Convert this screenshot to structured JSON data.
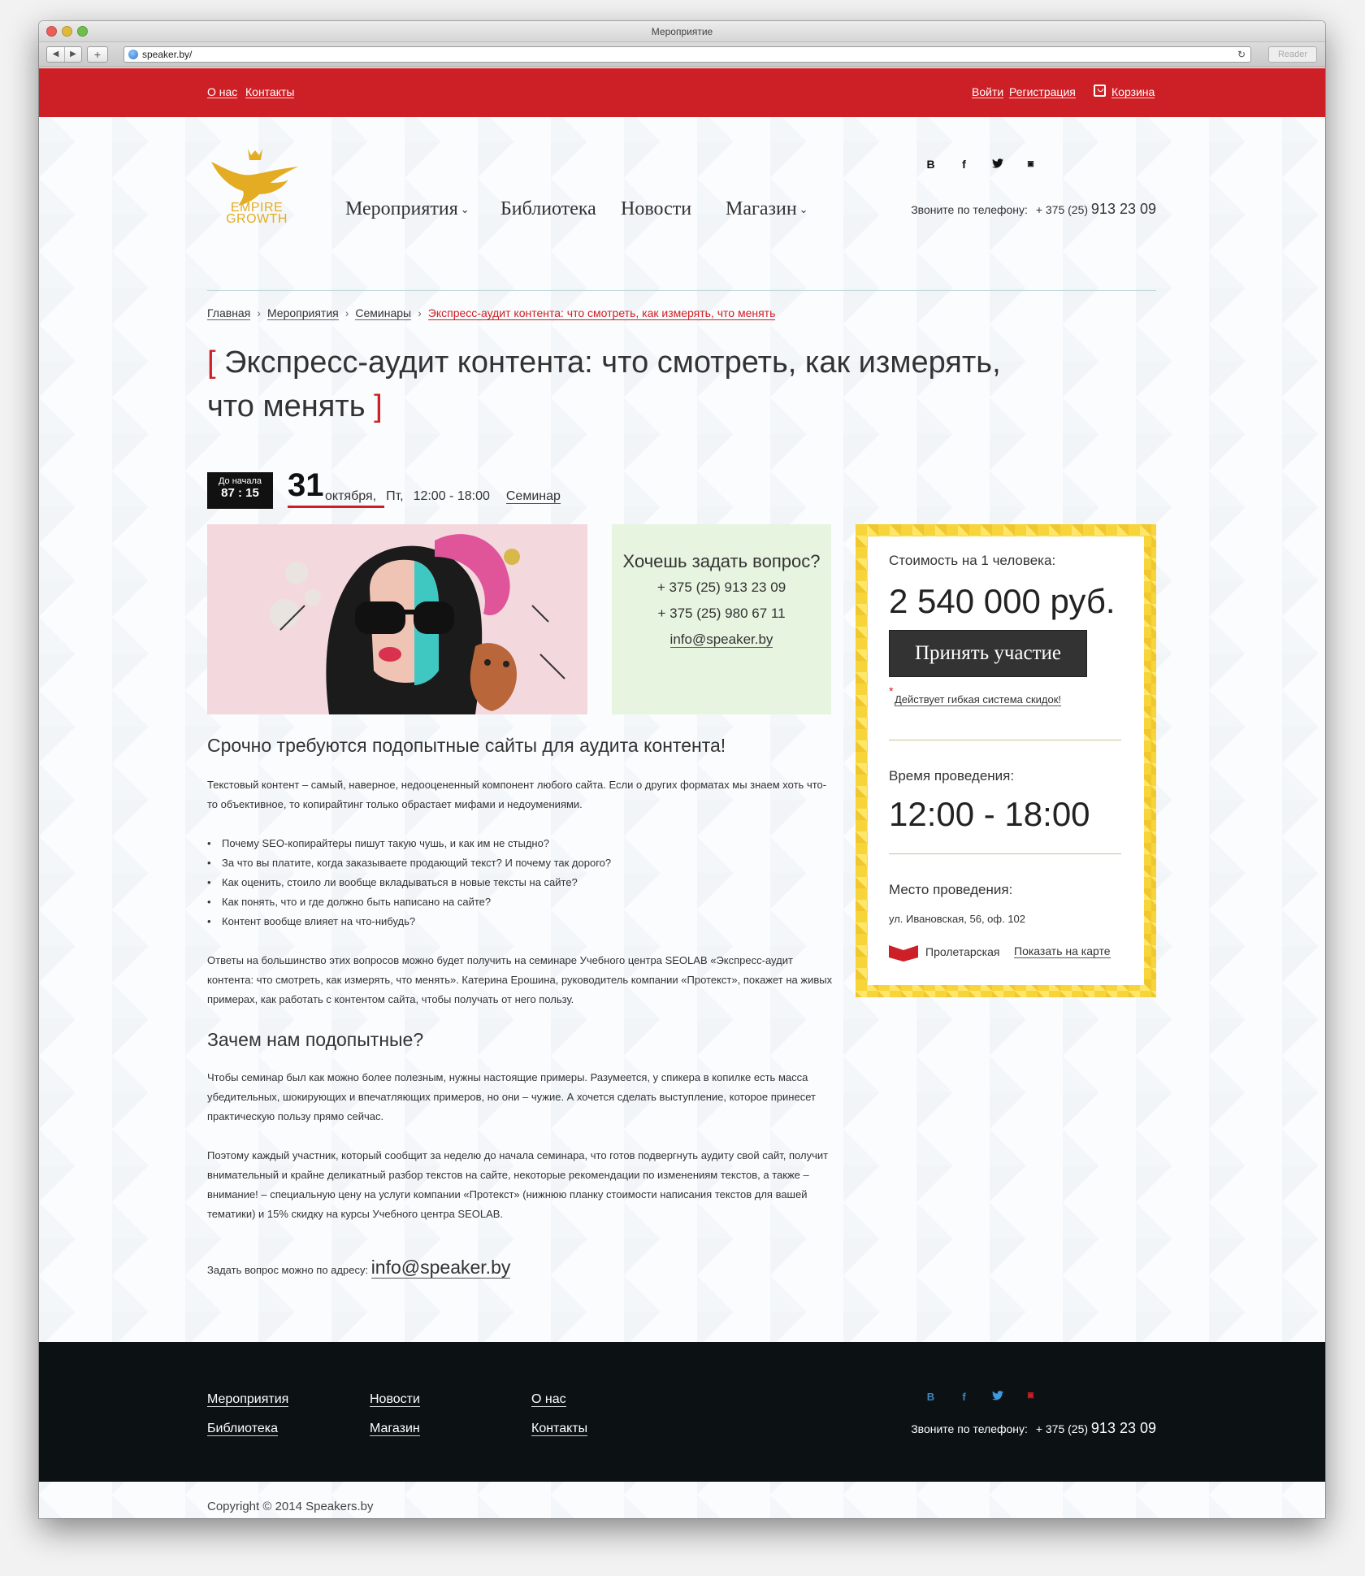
{
  "browser": {
    "window_title": "Мероприятие",
    "url": "speaker.by/",
    "reader_label": "Reader"
  },
  "topbar": {
    "about": "О нас",
    "contacts": "Контакты",
    "login": "Войти",
    "register": "Регистрация",
    "cart": "Корзина"
  },
  "logo": {
    "line1": "EMPIRE",
    "line2": "GROWTH"
  },
  "nav": {
    "events": "Мероприятия",
    "library": "Библиотека",
    "news": "Новости",
    "shop": "Магазин"
  },
  "social": {
    "vk": "В",
    "fb": "f",
    "tw": "t",
    "yt": "You"
  },
  "header_phone": {
    "label": "Звоните по телефону:",
    "code": "+ 375 (25)",
    "number": "913 23 09"
  },
  "breadcrumb": {
    "home": "Главная",
    "events": "Мероприятия",
    "seminars": "Семинары",
    "current": "Экспресс-аудит контента: что смотреть, как измерять, что менять"
  },
  "title": "Экспресс-аудит контента: что смотреть, как измерять, что менять",
  "countdown": {
    "label": "До начала",
    "value": "87 : 15"
  },
  "date": {
    "day": "31",
    "month": "октября,",
    "dow": "Пт,",
    "time": "12:00 - 18:00",
    "type": "Семинар"
  },
  "ask": {
    "heading": "Хочешь задать вопрос?",
    "phone1": "+ 375 (25) 913 23 09",
    "phone2": "+ 375 (25) 980 67 11",
    "email": "info@speaker.by"
  },
  "price": {
    "cost_label": "Стоимость на 1 человека:",
    "cost": "2 540 000 руб.",
    "button": "Принять участие",
    "star": "*",
    "note": "Действует гибкая система скидок!",
    "time_label": "Время проведения:",
    "time": "12:00 - 18:00",
    "place_label": "Место проведения:",
    "address": "ул. Ивановская, 56, оф. 102",
    "metro": "Пролетарская",
    "map_link": "Показать на карте"
  },
  "article": {
    "h1": "Срочно требуются подопытные сайты для аудита контента!",
    "p1": "Текстовый контент – самый, наверное, недооцененный компонент любого сайта. Если о других форматах мы знаем хоть что-то объективное, то копирайтинг только обрастает мифами и недоумениями.",
    "questions": [
      "Почему SEO-копирайтеры пишут такую чушь, и как им не стыдно?",
      "За что вы платите, когда заказываете продающий текст? И почему так дорого?",
      "Как оценить, стоило ли вообще вкладываться в новые тексты на сайте?",
      "Как понять, что и где должно быть написано на сайте?",
      "Контент вообще влияет на что-нибудь?"
    ],
    "p2": "Ответы на большинство этих вопросов можно будет получить на семинаре Учебного центра SEOLAB «Экспресс-аудит контента: что смотреть, как измерять, что менять». Катерина Ерошина, руководитель компании «Протекст», покажет на живых примерах, как работать с контентом сайта, чтобы получать от него пользу.",
    "h2": "Зачем нам подопытные?",
    "p3": "Чтобы семинар был как можно более полезным, нужны настоящие примеры. Разумеется, у спикера в копилке есть масса убедительных, шокирующих и впечатляющих примеров, но они – чужие. А хочется сделать выступление, которое принесет практическую пользу прямо сейчас.",
    "p4": "Поэтому каждый участник, который сообщит за неделю до начала семинара, что готов подвергнуть аудиту свой сайт, получит внимательный и крайне деликатный разбор текстов на сайте, некоторые рекомендации по изменениям текстов, а также – внимание! – специальную цену на услуги компании «Протекст» (нижнюю планку стоимости написания текстов для вашей тематики) и 15% скидку на курсы Учебного центра SEOLAB.",
    "ask_label": "Задать вопрос можно по адресу:",
    "ask_email": "info@speaker.by"
  },
  "footer": {
    "events": "Мероприятия",
    "library": "Библиотека",
    "news": "Новости",
    "shop": "Магазин",
    "about": "О нас",
    "contacts": "Контакты",
    "phone_label": "Звоните по телефону:",
    "phone_code": "+ 375 (25)",
    "phone_number": "913 23 09"
  },
  "copyright": "Copyright © 2014 Speakers.by",
  "colors": {
    "accent": "#cd2026",
    "footer_bg": "#0c1114",
    "ask_bg": "#e6f4e0",
    "price_frame": "#f7d53a"
  }
}
